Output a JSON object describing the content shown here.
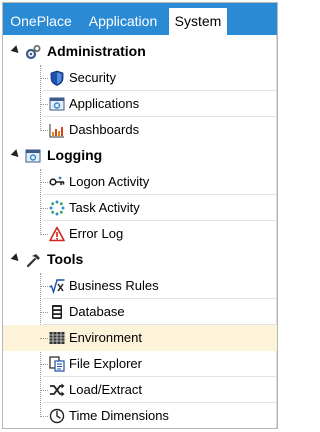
{
  "tabs": [
    {
      "label": "OnePlace"
    },
    {
      "label": "Application"
    },
    {
      "label": "System"
    }
  ],
  "tree": {
    "administration": {
      "label": "Administration",
      "items": [
        {
          "label": "Security"
        },
        {
          "label": "Applications"
        },
        {
          "label": "Dashboards"
        }
      ]
    },
    "logging": {
      "label": "Logging",
      "items": [
        {
          "label": "Logon Activity"
        },
        {
          "label": "Task Activity"
        },
        {
          "label": "Error Log"
        }
      ]
    },
    "tools": {
      "label": "Tools",
      "items": [
        {
          "label": "Business Rules"
        },
        {
          "label": "Database"
        },
        {
          "label": "Environment"
        },
        {
          "label": "File Explorer"
        },
        {
          "label": "Load/Extract"
        },
        {
          "label": "Time Dimensions"
        }
      ]
    }
  },
  "colors": {
    "tab_bar": "#2a8ad4",
    "selected_row": "#fcf3d9"
  }
}
